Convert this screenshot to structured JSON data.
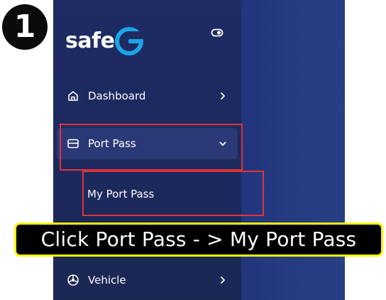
{
  "step": {
    "number": "1"
  },
  "logo": {
    "text": "safe"
  },
  "sidebar": {
    "items": [
      {
        "label": "Dashboard"
      },
      {
        "label": "Port Pass"
      },
      {
        "label": "Vehicle"
      }
    ],
    "subitems": [
      {
        "label": "My Port Pass"
      }
    ]
  },
  "instruction": {
    "text": "Click Port Pass - > My Port Pass"
  },
  "colors": {
    "sidebar_bg": "#1f2b63",
    "active_item_bg": "#2b3a76",
    "highlight_red": "#e0333a",
    "logo_accent": "#1aa5e6",
    "instruction_border": "#fff400"
  }
}
